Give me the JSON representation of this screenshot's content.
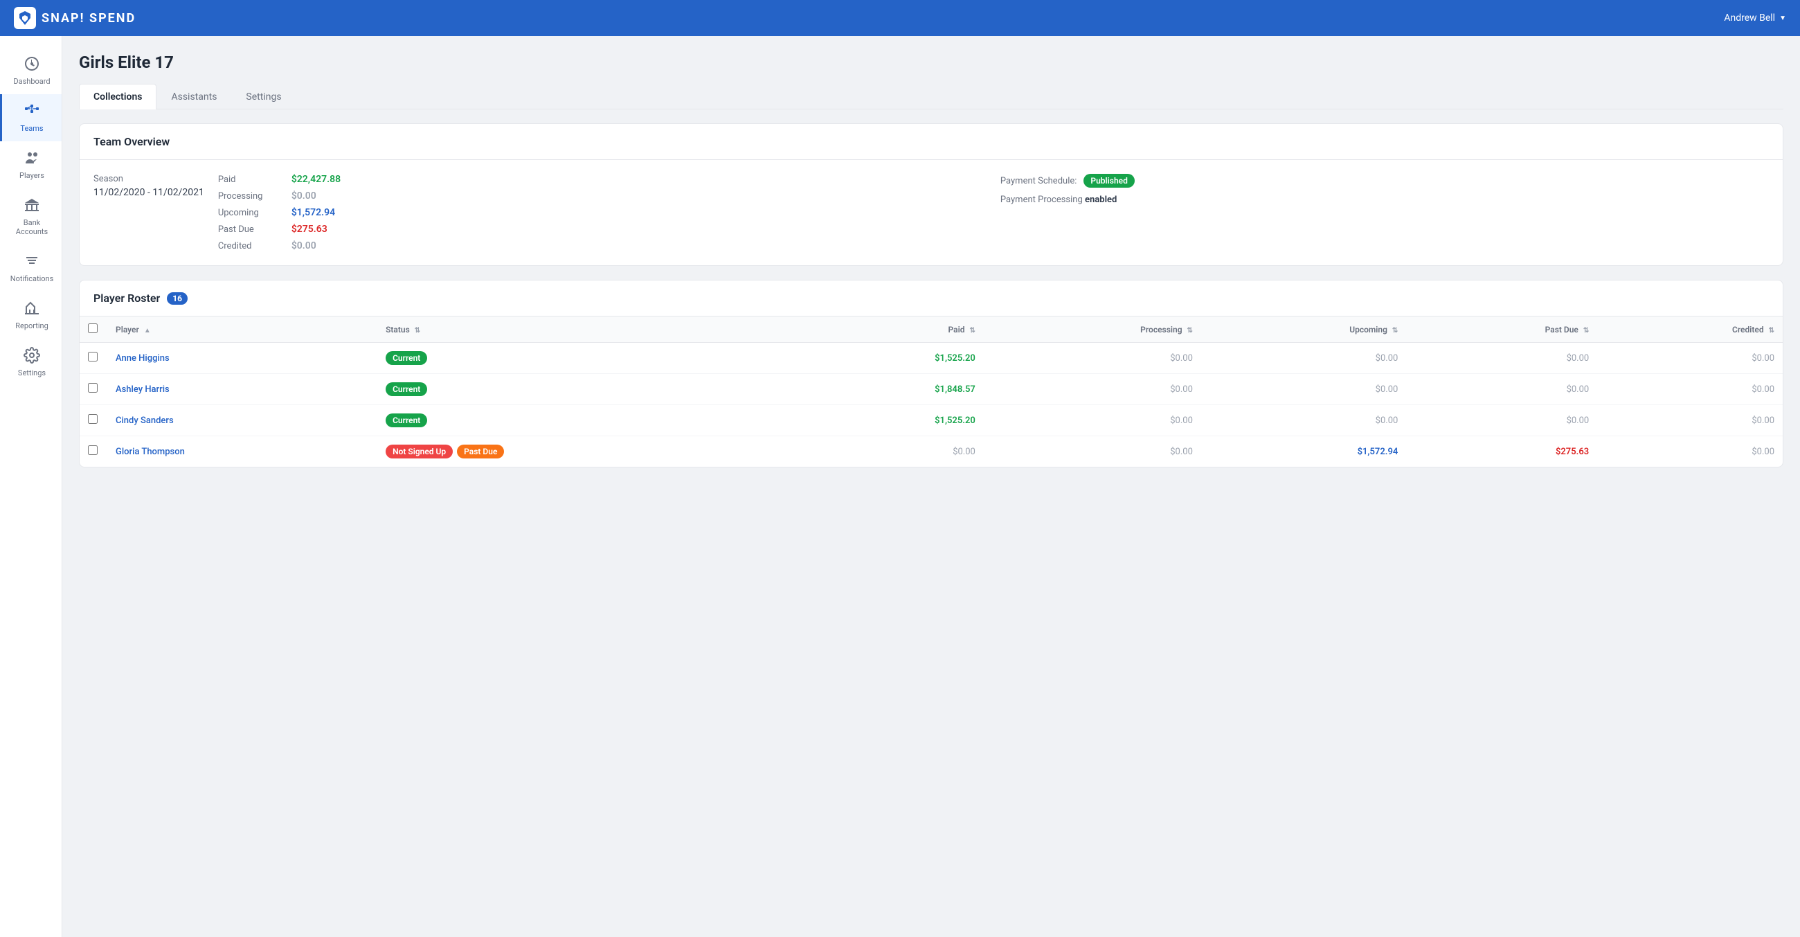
{
  "app": {
    "name": "SNAP! SPEND",
    "user": "Andrew Bell"
  },
  "sidebar": {
    "items": [
      {
        "id": "dashboard",
        "label": "Dashboard",
        "icon": "dashboard"
      },
      {
        "id": "teams",
        "label": "Teams",
        "icon": "teams",
        "active": true
      },
      {
        "id": "players",
        "label": "Players",
        "icon": "players"
      },
      {
        "id": "bank-accounts",
        "label": "Bank Accounts",
        "icon": "bank"
      },
      {
        "id": "notifications",
        "label": "Notifications",
        "icon": "notifications"
      },
      {
        "id": "reporting",
        "label": "Reporting",
        "icon": "reporting"
      },
      {
        "id": "settings",
        "label": "Settings",
        "icon": "settings"
      }
    ]
  },
  "page": {
    "title": "Girls Elite 17",
    "tabs": [
      {
        "id": "collections",
        "label": "Collections",
        "active": true
      },
      {
        "id": "assistants",
        "label": "Assistants",
        "active": false
      },
      {
        "id": "settings",
        "label": "Settings",
        "active": false
      }
    ]
  },
  "team_overview": {
    "section_title": "Team Overview",
    "season_label": "Season",
    "season_value": "11/02/2020 - 11/02/2021",
    "financials": [
      {
        "label": "Paid",
        "value": "$22,427.88",
        "type": "green"
      },
      {
        "label": "Processing",
        "value": "$0.00",
        "type": "gray"
      },
      {
        "label": "Upcoming",
        "value": "$1,572.94",
        "type": "blue"
      },
      {
        "label": "Past Due",
        "value": "$275.63",
        "type": "red"
      },
      {
        "label": "Credited",
        "value": "$0.00",
        "type": "gray"
      }
    ],
    "payment_schedule_label": "Payment Schedule:",
    "payment_schedule_badge": "Published",
    "payment_processing_label": "Payment Processing",
    "payment_processing_value": "enabled"
  },
  "player_roster": {
    "title": "Player Roster",
    "count": "16",
    "columns": [
      {
        "id": "checkbox",
        "label": ""
      },
      {
        "id": "player",
        "label": "Player",
        "sortable": true
      },
      {
        "id": "status",
        "label": "Status",
        "sortable": true
      },
      {
        "id": "paid",
        "label": "Paid",
        "sortable": true,
        "align": "right"
      },
      {
        "id": "processing",
        "label": "Processing",
        "sortable": true,
        "align": "right"
      },
      {
        "id": "upcoming",
        "label": "Upcoming",
        "sortable": true,
        "align": "right"
      },
      {
        "id": "past_due",
        "label": "Past Due",
        "sortable": true,
        "align": "right"
      },
      {
        "id": "credited",
        "label": "Credited",
        "sortable": true,
        "align": "right"
      }
    ],
    "rows": [
      {
        "player": "Anne Higgins",
        "statuses": [
          "Current"
        ],
        "paid": "$1,525.20",
        "processing": "$0.00",
        "upcoming": "$0.00",
        "past_due": "$0.00",
        "credited": "$0.00",
        "paid_type": "green",
        "processing_type": "gray",
        "upcoming_type": "gray",
        "past_due_type": "gray",
        "credited_type": "gray"
      },
      {
        "player": "Ashley Harris",
        "statuses": [
          "Current"
        ],
        "paid": "$1,848.57",
        "processing": "$0.00",
        "upcoming": "$0.00",
        "past_due": "$0.00",
        "credited": "$0.00",
        "paid_type": "green",
        "processing_type": "gray",
        "upcoming_type": "gray",
        "past_due_type": "gray",
        "credited_type": "gray"
      },
      {
        "player": "Cindy Sanders",
        "statuses": [
          "Current"
        ],
        "paid": "$1,525.20",
        "processing": "$0.00",
        "upcoming": "$0.00",
        "past_due": "$0.00",
        "credited": "$0.00",
        "paid_type": "green",
        "processing_type": "gray",
        "upcoming_type": "gray",
        "past_due_type": "gray",
        "credited_type": "gray"
      },
      {
        "player": "Gloria Thompson",
        "statuses": [
          "Not Signed Up",
          "Past Due"
        ],
        "paid": "$0.00",
        "processing": "$0.00",
        "upcoming": "$1,572.94",
        "past_due": "$275.63",
        "credited": "$0.00",
        "paid_type": "gray",
        "processing_type": "gray",
        "upcoming_type": "blue",
        "past_due_type": "red",
        "credited_type": "gray"
      }
    ]
  },
  "colors": {
    "primary": "#2563c7",
    "green": "#16a34a",
    "red": "#dc2626",
    "orange": "#f97316",
    "blue": "#2563c7",
    "gray": "#9ca3af"
  }
}
